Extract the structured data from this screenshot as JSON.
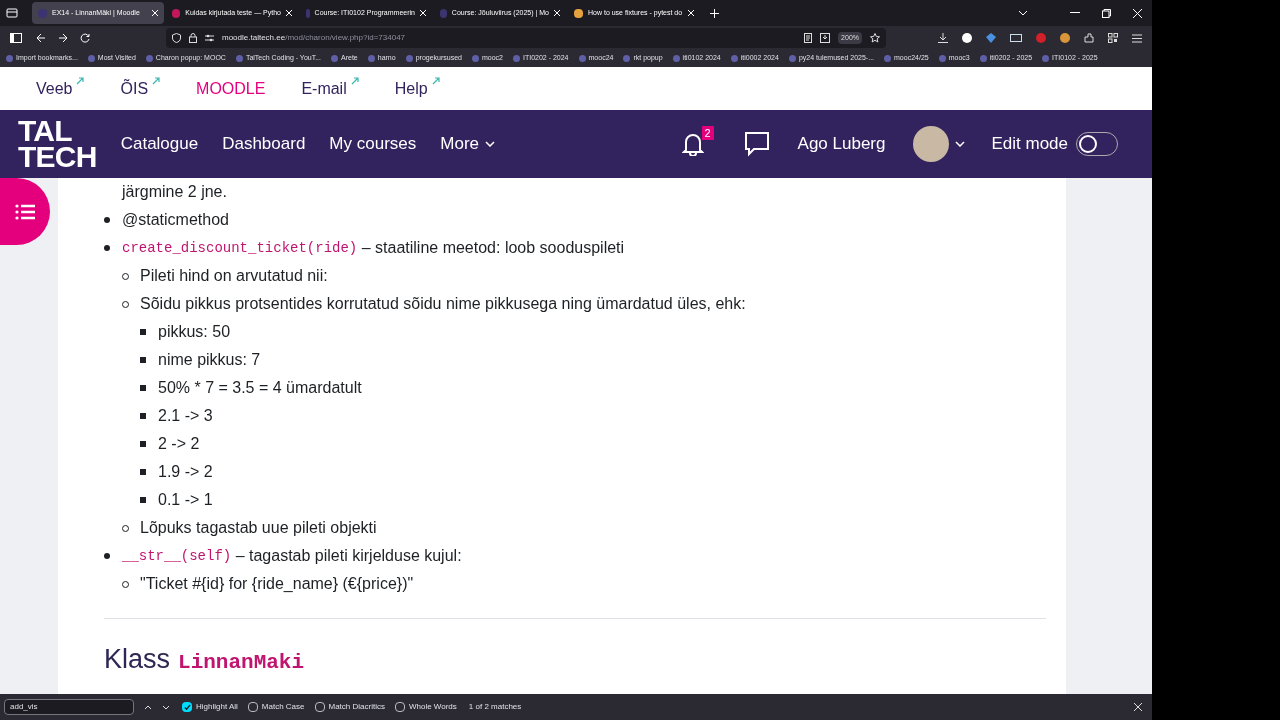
{
  "browser": {
    "tabs": [
      {
        "title": "EX14 - LinnanMäki | Moodle",
        "selected": true
      },
      {
        "title": "Kuidas kirjutada teste — Pytho",
        "selected": false
      },
      {
        "title": "Course: ITI0102 Programmeerin",
        "selected": false
      },
      {
        "title": "Course: Jõuluviirus (2025) | Mo",
        "selected": false
      },
      {
        "title": "How to use fixtures - pytest do",
        "selected": false
      }
    ],
    "address_host": "moodle.taltech.ee",
    "address_path": "/mod/charon/view.php?id=734047",
    "zoom": "200%",
    "bookmarks": [
      "Import bookmarks...",
      "Most Visited",
      "Charon popup: MOOC",
      "TalTech Coding - YouT...",
      "Arete",
      "harno",
      "progekursused",
      "mooc2",
      "ITI0202 - 2024",
      "mooc24",
      "rkt popup",
      "iti0102 2024",
      "iti0002 2024",
      "py24 tulemused 2025-...",
      "mooc24/25",
      "mooc3",
      "iti0202 - 2025",
      "ITI0102 - 2025"
    ]
  },
  "site_links": [
    {
      "label": "Veeb",
      "selected": false
    },
    {
      "label": "ÕIS",
      "selected": false
    },
    {
      "label": "MOODLE",
      "selected": true
    },
    {
      "label": "E-mail",
      "selected": false
    },
    {
      "label": "Help",
      "selected": false
    }
  ],
  "header": {
    "logo": [
      "TAL",
      "TECH"
    ],
    "nav": [
      "Catalogue",
      "Dashboard",
      "My courses",
      "More"
    ],
    "notifications": "2",
    "user": "Ago Luberg",
    "edit_mode_label": "Edit mode",
    "edit_mode": false
  },
  "content": {
    "lead": "järgmine 2 jne.",
    "items": [
      {
        "text": "@staticmethod"
      },
      {
        "code": "create_discount_ticket(ride)",
        "text": " – staatiline meetod: loob sooduspileti",
        "children": [
          {
            "text": "Pileti hind on arvutatud nii:"
          },
          {
            "text": "Sõidu pikkus protsentides korrutatud sõidu nime pikkusega ning ümardatud üles, ehk:",
            "children": [
              {
                "text": "pikkus: 50"
              },
              {
                "text": "nime pikkus: 7"
              },
              {
                "text": "50% * 7 = 3.5 = 4 ümardatult"
              },
              {
                "text": "2.1 -> 3"
              },
              {
                "text": "2 -> 2"
              },
              {
                "text": "1.9 -> 2"
              },
              {
                "text": "0.1 -> 1"
              }
            ]
          },
          {
            "text": "Lõpuks tagastab uue pileti objekti"
          }
        ]
      },
      {
        "code": "__str__(self)",
        "text": " – tagastab pileti kirjelduse kujul:",
        "children": [
          {
            "text": "\"Ticket #{id} for {ride_name} (€{price})\""
          }
        ]
      }
    ],
    "heading": "Klass",
    "heading_code": "LinnanMaki"
  },
  "find_bar": {
    "query": "add_vis",
    "options": [
      {
        "label": "Highlight All",
        "checked": true
      },
      {
        "label": "Match Case",
        "checked": false
      },
      {
        "label": "Match Diacritics",
        "checked": false
      },
      {
        "label": "Whole Words",
        "checked": false
      }
    ],
    "matches": "1 of 2 matches"
  }
}
